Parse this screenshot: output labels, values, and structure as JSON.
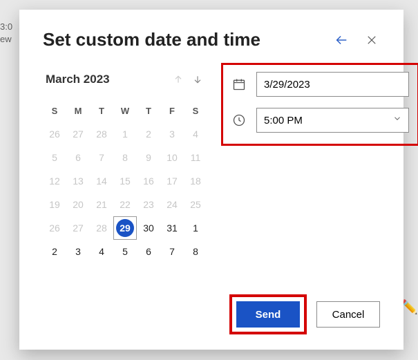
{
  "background": {
    "line1": "3:0",
    "line2": "ew"
  },
  "modal": {
    "title": "Set custom date and time",
    "calendar": {
      "month_label": "March 2023",
      "dow": [
        "S",
        "M",
        "T",
        "W",
        "T",
        "F",
        "S"
      ],
      "days": [
        {
          "n": 26,
          "dim": true
        },
        {
          "n": 27,
          "dim": true
        },
        {
          "n": 28,
          "dim": true
        },
        {
          "n": 1,
          "dim": true
        },
        {
          "n": 2,
          "dim": true
        },
        {
          "n": 3,
          "dim": true
        },
        {
          "n": 4,
          "dim": true
        },
        {
          "n": 5,
          "dim": true
        },
        {
          "n": 6,
          "dim": true
        },
        {
          "n": 7,
          "dim": true
        },
        {
          "n": 8,
          "dim": true
        },
        {
          "n": 9,
          "dim": true
        },
        {
          "n": 10,
          "dim": true
        },
        {
          "n": 11,
          "dim": true
        },
        {
          "n": 12,
          "dim": true
        },
        {
          "n": 13,
          "dim": true
        },
        {
          "n": 14,
          "dim": true
        },
        {
          "n": 15,
          "dim": true
        },
        {
          "n": 16,
          "dim": true
        },
        {
          "n": 17,
          "dim": true
        },
        {
          "n": 18,
          "dim": true
        },
        {
          "n": 19,
          "dim": true
        },
        {
          "n": 20,
          "dim": true
        },
        {
          "n": 21,
          "dim": true
        },
        {
          "n": 22,
          "dim": true
        },
        {
          "n": 23,
          "dim": true
        },
        {
          "n": 24,
          "dim": true
        },
        {
          "n": 25,
          "dim": true
        },
        {
          "n": 26,
          "dim": true
        },
        {
          "n": 27,
          "dim": true
        },
        {
          "n": 28,
          "dim": true
        },
        {
          "n": 29,
          "dim": false,
          "selected": true
        },
        {
          "n": 30,
          "dim": false
        },
        {
          "n": 31,
          "dim": false
        },
        {
          "n": 1,
          "dim": false
        },
        {
          "n": 2,
          "dim": false
        },
        {
          "n": 3,
          "dim": false
        },
        {
          "n": 4,
          "dim": false
        },
        {
          "n": 5,
          "dim": false
        },
        {
          "n": 6,
          "dim": false
        },
        {
          "n": 7,
          "dim": false
        },
        {
          "n": 8,
          "dim": false
        }
      ]
    },
    "date_field": {
      "value": "3/29/2023"
    },
    "time_field": {
      "value": "5:00 PM"
    },
    "buttons": {
      "send": "Send",
      "cancel": "Cancel"
    }
  }
}
